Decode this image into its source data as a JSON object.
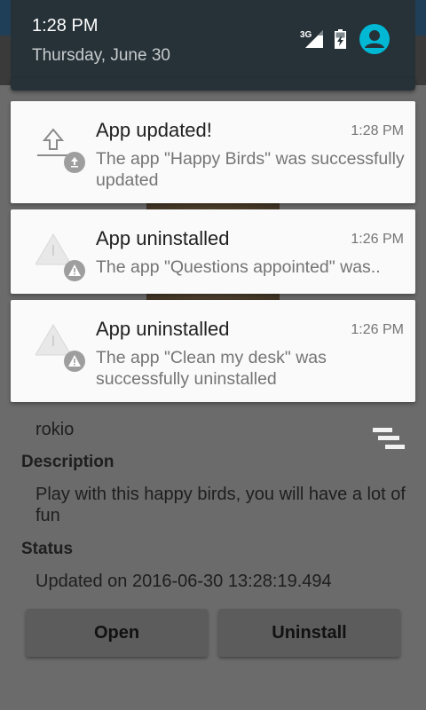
{
  "status_bar": {
    "time": "1:28 PM",
    "date": "Thursday, June 30",
    "network_label": "3G"
  },
  "notifications": [
    {
      "icon": "upload-icon",
      "title": "App updated!",
      "time": "1:28 PM",
      "text": "The app \"Happy Birds\" was successfully updated"
    },
    {
      "icon": "warning-icon",
      "title": "App uninstalled",
      "time": "1:26 PM",
      "text": "The app \"Questions appointed\" was.."
    },
    {
      "icon": "warning-icon",
      "title": "App uninstalled",
      "time": "1:26 PM",
      "text": "The app \"Clean my desk\" was successfully uninstalled"
    }
  ],
  "app_details": {
    "developer": "rokio",
    "description_heading": "Description",
    "description": "Play with this happy birds, you will have a lot of fun",
    "status_heading": "Status",
    "status": "Updated on 2016-06-30 13:28:19.494",
    "open_button": "Open",
    "uninstall_button": "Uninstall"
  },
  "colors": {
    "shade_header": "#263238",
    "accent_avatar": "#00b8d4",
    "card_background": "#fafafa"
  }
}
